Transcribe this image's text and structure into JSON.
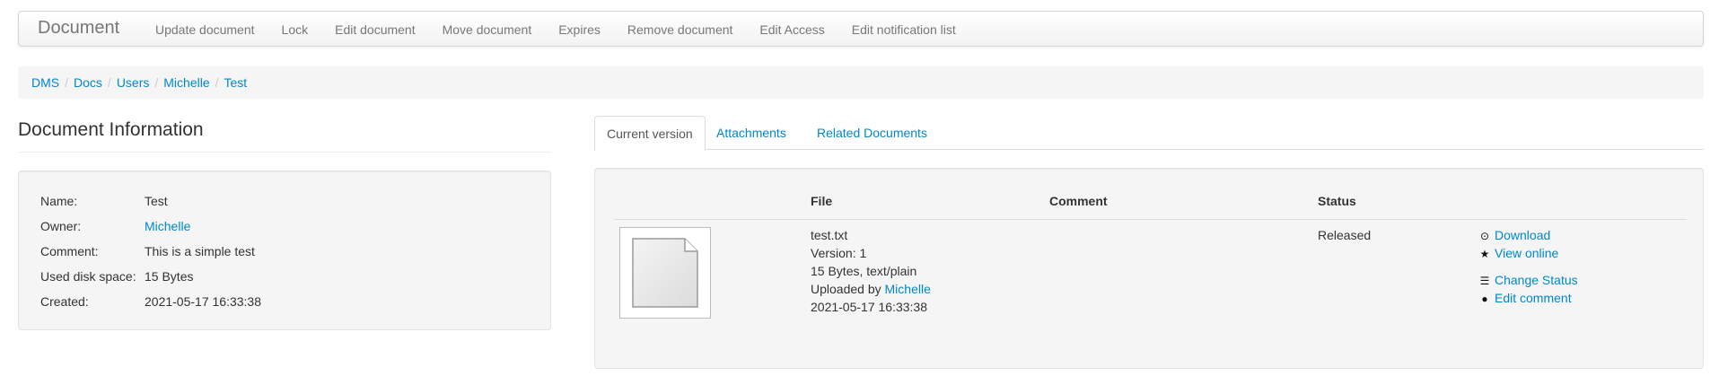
{
  "navbar": {
    "brand": "Document",
    "items": [
      {
        "label": "Update document"
      },
      {
        "label": "Lock"
      },
      {
        "label": "Edit document"
      },
      {
        "label": "Move document"
      },
      {
        "label": "Expires"
      },
      {
        "label": "Remove document"
      },
      {
        "label": "Edit Access"
      },
      {
        "label": "Edit notification list"
      }
    ]
  },
  "breadcrumb": [
    "DMS",
    "Docs",
    "Users",
    "Michelle",
    "Test"
  ],
  "breadcrumb_separator": "/",
  "document_info": {
    "title": "Document Information",
    "name_label": "Name:",
    "name_value": "Test",
    "owner_label": "Owner:",
    "owner_value": "Michelle",
    "comment_label": "Comment:",
    "comment_value": "This is a simple test",
    "disk_label": "Used disk space:",
    "disk_value": "15 Bytes",
    "created_label": "Created:",
    "created_value": "2021-05-17 16:33:38"
  },
  "tabs": [
    {
      "label": "Current version",
      "active": true
    },
    {
      "label": "Attachments",
      "active": false
    },
    {
      "label": "Related Documents",
      "active": false
    }
  ],
  "version_table": {
    "headers": {
      "file": "File",
      "comment": "Comment",
      "status": "Status"
    },
    "row": {
      "filename": "test.txt",
      "version": "Version: 1",
      "size_type": "15 Bytes, text/plain",
      "uploaded_prefix": "Uploaded by",
      "uploaded_by": "Michelle",
      "date": "2021-05-17 16:33:38",
      "comment": "",
      "status": "Released"
    },
    "actions": [
      {
        "label": "Download",
        "icon": "download-icon"
      },
      {
        "label": "View online",
        "icon": "star-icon"
      },
      {
        "label": "Change Status",
        "icon": "list-icon"
      },
      {
        "label": "Edit comment",
        "icon": "comment-icon"
      }
    ]
  },
  "colors": {
    "link": "#0088cc",
    "text": "#333333",
    "muted": "#777777"
  }
}
